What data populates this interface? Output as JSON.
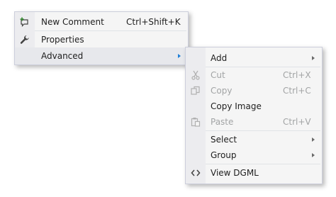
{
  "main_menu": {
    "items": [
      {
        "label": "New Comment",
        "shortcut": "Ctrl+Shift+K",
        "icon": "new-comment-icon"
      },
      {
        "label": "Properties",
        "shortcut": "",
        "icon": "wrench-icon"
      },
      {
        "label": "Advanced",
        "shortcut": "",
        "icon": "",
        "submenu": true
      }
    ]
  },
  "advanced_submenu": {
    "items": [
      {
        "label": "Add",
        "shortcut": "",
        "submenu": true,
        "enabled": true
      },
      {
        "label": "Cut",
        "shortcut": "Ctrl+X",
        "icon": "scissors-icon",
        "enabled": false
      },
      {
        "label": "Copy",
        "shortcut": "Ctrl+C",
        "icon": "copy-icon",
        "enabled": false
      },
      {
        "label": "Copy Image",
        "shortcut": "",
        "enabled": true
      },
      {
        "label": "Paste",
        "shortcut": "Ctrl+V",
        "icon": "paste-icon",
        "enabled": false
      },
      {
        "label": "Select",
        "shortcut": "",
        "submenu": true,
        "enabled": true
      },
      {
        "label": "Group",
        "shortcut": "",
        "submenu": true,
        "enabled": true
      },
      {
        "label": "View DGML",
        "shortcut": "",
        "icon": "code-brackets-icon",
        "enabled": true
      }
    ]
  },
  "colors": {
    "menu_background": "#f5f5f5",
    "menu_border": "#cccedb",
    "highlight": "#e6e6e6",
    "disabled_text": "#a2a4a5",
    "submenu_arrow_active": "#1e7fd8",
    "new_comment_plus": "#388a34"
  }
}
